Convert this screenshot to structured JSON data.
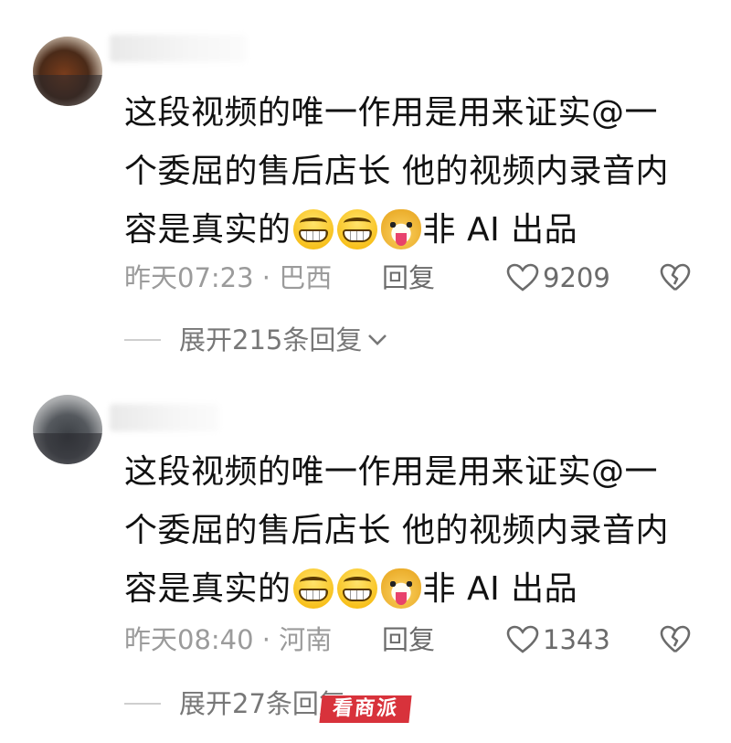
{
  "comments": [
    {
      "text_line1": "这段视频的唯一作用是用来证实@一",
      "text_line2": "个委屈的售后店长 他的视频内录音内",
      "text_line3_prefix": "容是真实的",
      "text_line3_suffix": "非 AI 出品",
      "time": "昨天07:23 · 巴西",
      "reply_label": "回复",
      "likes": "9209",
      "expand_label": "展开215条回复"
    },
    {
      "text_line1": "这段视频的唯一作用是用来证实@一",
      "text_line2": "个委屈的售后店长 他的视频内录音内",
      "text_line3_prefix": "容是真实的",
      "text_line3_suffix": "非 AI 出品",
      "time": "昨天08:40 · 河南",
      "reply_label": "回复",
      "likes": "1343",
      "expand_label": "展开27条回复"
    }
  ],
  "icons": {
    "emoji_1": "grinning-face-emoji",
    "emoji_2": "grinning-face-emoji",
    "emoji_3": "dog-face-emoji",
    "like": "heart-outline-icon",
    "dislike": "broken-heart-icon",
    "expand": "chevron-down-icon"
  },
  "watermark": "看商派"
}
